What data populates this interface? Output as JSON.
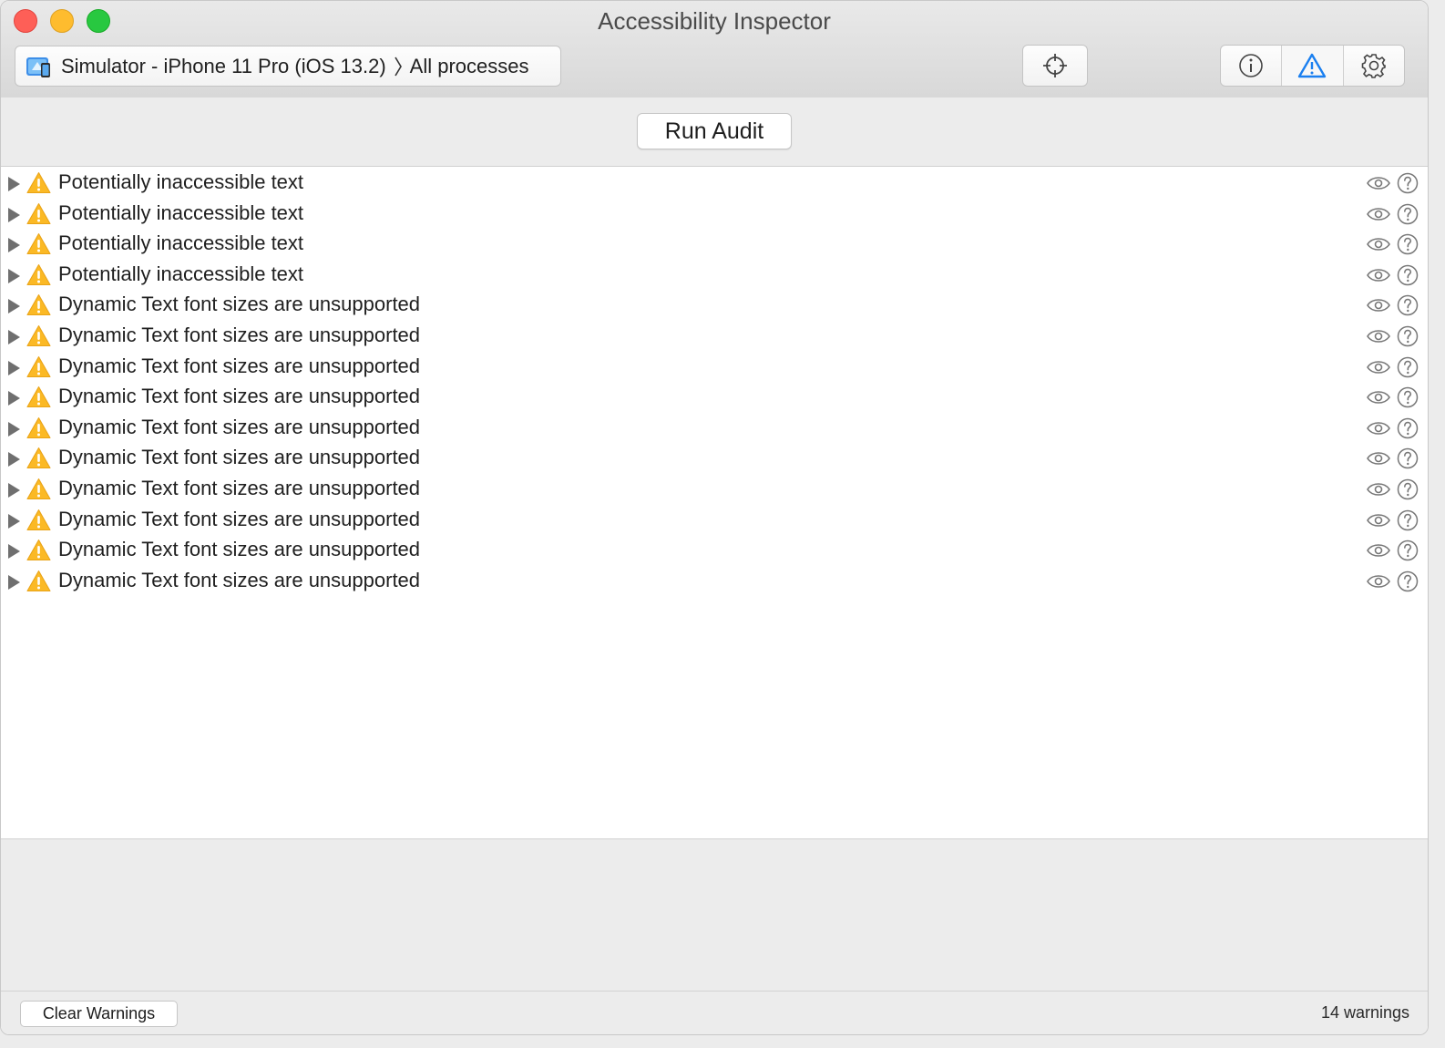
{
  "window": {
    "title": "Accessibility Inspector"
  },
  "toolbar": {
    "target_device": "Simulator - iPhone 11 Pro (iOS 13.2)",
    "target_process": "All processes",
    "buttons": {
      "target": "crosshair-icon",
      "inspect": "info-icon",
      "audit": "warning-icon",
      "settings": "gear-icon"
    },
    "active_tab": "audit",
    "accent_color": "#1a7ff0"
  },
  "audit": {
    "run_label": "Run Audit"
  },
  "warnings": [
    {
      "label": "Potentially inaccessible text"
    },
    {
      "label": "Potentially inaccessible text"
    },
    {
      "label": "Potentially inaccessible text"
    },
    {
      "label": "Potentially inaccessible text"
    },
    {
      "label": "Dynamic Text font sizes are unsupported"
    },
    {
      "label": "Dynamic Text font sizes are unsupported"
    },
    {
      "label": "Dynamic Text font sizes are unsupported"
    },
    {
      "label": "Dynamic Text font sizes are unsupported"
    },
    {
      "label": "Dynamic Text font sizes are unsupported"
    },
    {
      "label": "Dynamic Text font sizes are unsupported"
    },
    {
      "label": "Dynamic Text font sizes are unsupported"
    },
    {
      "label": "Dynamic Text font sizes are unsupported"
    },
    {
      "label": "Dynamic Text font sizes are unsupported"
    },
    {
      "label": "Dynamic Text font sizes are unsupported"
    }
  ],
  "footer": {
    "clear_label": "Clear Warnings",
    "count_label": "14 warnings"
  }
}
